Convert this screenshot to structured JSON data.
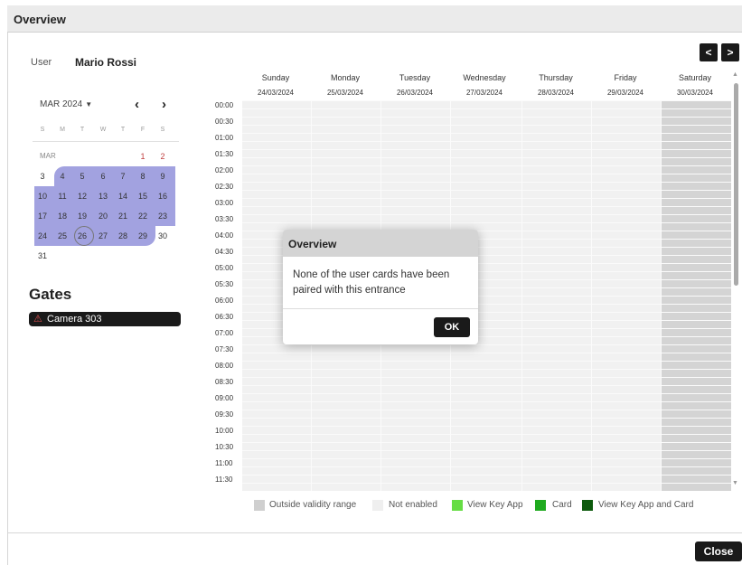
{
  "window": {
    "title": "Overview"
  },
  "user": {
    "label": "User",
    "name": "Mario Rossi"
  },
  "calendar": {
    "month_label": "MAR 2024",
    "prev_icon": "chevron-left-icon",
    "next_icon": "chevron-right-icon",
    "weekday_headers": [
      "S",
      "M",
      "T",
      "W",
      "T",
      "F",
      "S"
    ],
    "section_label": "MAR",
    "weeks": [
      [
        "",
        "",
        "",
        "",
        "",
        "1",
        "2"
      ],
      [
        "3",
        "4",
        "5",
        "6",
        "7",
        "8",
        "9"
      ],
      [
        "10",
        "11",
        "12",
        "13",
        "14",
        "15",
        "16"
      ],
      [
        "17",
        "18",
        "19",
        "20",
        "21",
        "22",
        "23"
      ],
      [
        "24",
        "25",
        "26",
        "27",
        "28",
        "29",
        "30"
      ],
      [
        "31",
        "",
        "",
        "",
        "",
        "",
        ""
      ]
    ],
    "today": "26",
    "selected_range": [
      "4",
      "29"
    ]
  },
  "gates": {
    "title": "Gates",
    "items": [
      {
        "label": "Camera 303",
        "icon": "warning-icon"
      }
    ]
  },
  "week": {
    "prev_label": "<",
    "next_label": ">",
    "days": [
      {
        "name": "Sunday",
        "date": "24/03/2024"
      },
      {
        "name": "Monday",
        "date": "25/03/2024"
      },
      {
        "name": "Tuesday",
        "date": "26/03/2024"
      },
      {
        "name": "Wednesday",
        "date": "27/03/2024"
      },
      {
        "name": "Thursday",
        "date": "28/03/2024"
      },
      {
        "name": "Friday",
        "date": "29/03/2024"
      },
      {
        "name": "Saturday",
        "date": "30/03/2024"
      }
    ],
    "times": [
      "00:00",
      "00:30",
      "01:00",
      "01:30",
      "02:00",
      "02:30",
      "03:00",
      "03:30",
      "04:00",
      "04:30",
      "05:00",
      "05:30",
      "06:00",
      "06:30",
      "07:00",
      "07:30",
      "08:00",
      "08:30",
      "09:00",
      "09:30",
      "10:00",
      "10:30",
      "11:00",
      "11:30"
    ]
  },
  "legend": [
    {
      "label": "Outside validity range",
      "color": "#cfcfcf"
    },
    {
      "label": "Not enabled",
      "color": "#efefef"
    },
    {
      "label": "View Key App",
      "color": "#66dd44"
    },
    {
      "label": "Card",
      "color": "#1faa1f"
    },
    {
      "label": "View Key App and Card",
      "color": "#0d5a0d"
    }
  ],
  "dialog": {
    "title": "Overview",
    "message": "None of the user cards have been paired with this entrance",
    "ok_label": "OK"
  },
  "footer": {
    "close_label": "Close"
  }
}
